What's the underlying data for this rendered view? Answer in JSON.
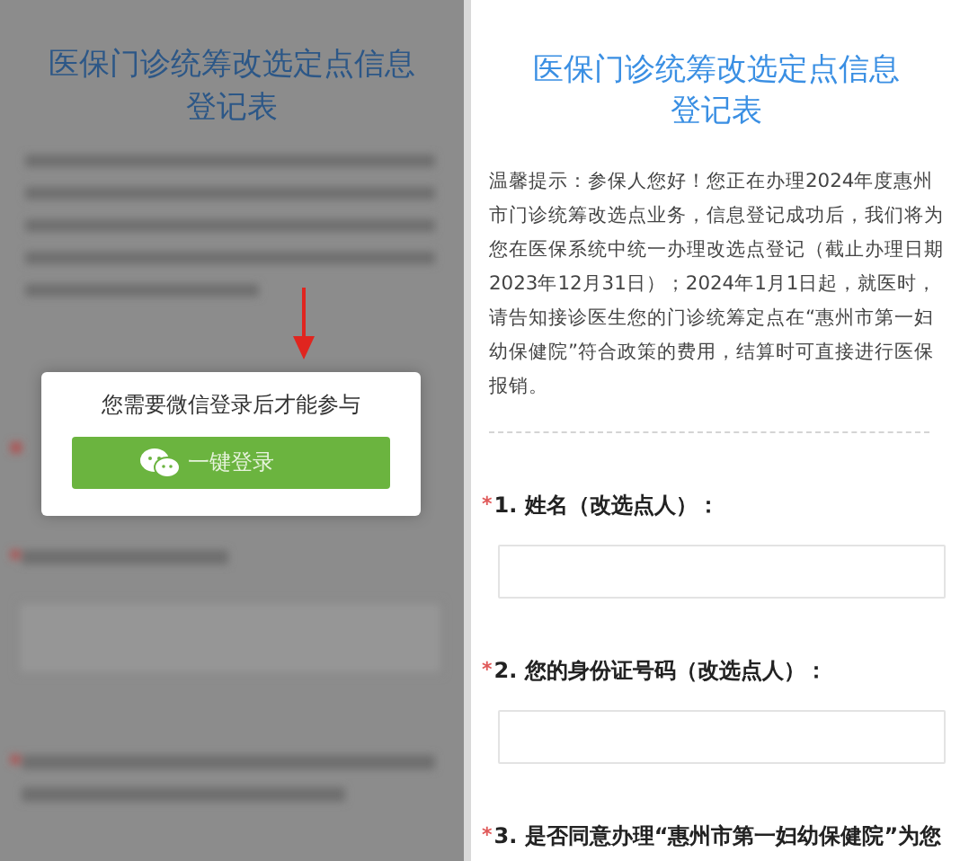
{
  "left_screen": {
    "title": "医保门诊统筹改选定点信息登记表",
    "login_dialog": {
      "message": "您需要微信登录后才能参与",
      "button": "一键登录"
    }
  },
  "right_screen": {
    "title": "医保门诊统筹改选定点信息登记表",
    "notice": "温馨提示：参保人您好！您正在办理2024年度惠州市门诊统筹改选点业务，信息登记成功后，我们将为您在医保系统中统一办理改选点登记（截止办理日期2023年12月31日）；2024年1月1日起，就医时，请告知接诊医生您的门诊统筹定点在“惠州市第一妇幼保健院”符合政策的费用，结算时可直接进行医保报销。",
    "questions": [
      {
        "kind": "text_field",
        "required_mark": "*",
        "label": "1. 姓名（改选点人）："
      },
      {
        "kind": "text_field",
        "required_mark": "*",
        "label": "2. 您的身份证号码（改选点人）："
      },
      {
        "kind": "question",
        "required_mark": "*",
        "label": "3. 是否同意办理“惠州市第一妇幼保健院”为您"
      }
    ]
  }
}
